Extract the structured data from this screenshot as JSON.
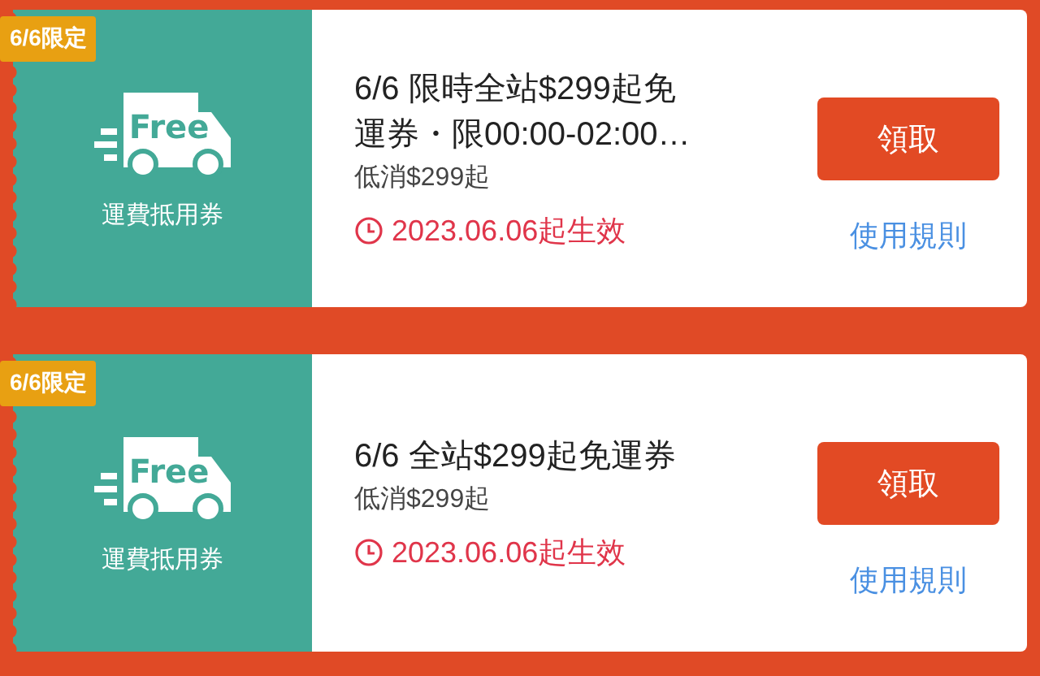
{
  "coupons": [
    {
      "badge": "6/6限定",
      "icon_text": "Free",
      "type_label": "運費抵用券",
      "title": "6/6 限時全站$299起免運券・限00:00-02:00…",
      "min_spend": "低消$299起",
      "valid_from": "2023.06.06起生效",
      "claim_button": "領取",
      "rules_link": "使用規則"
    },
    {
      "badge": "6/6限定",
      "icon_text": "Free",
      "type_label": "運費抵用券",
      "title": "6/6 全站$299起免運券",
      "min_spend": "低消$299起",
      "valid_from": "2023.06.06起生效",
      "claim_button": "領取",
      "rules_link": "使用規則"
    }
  ]
}
